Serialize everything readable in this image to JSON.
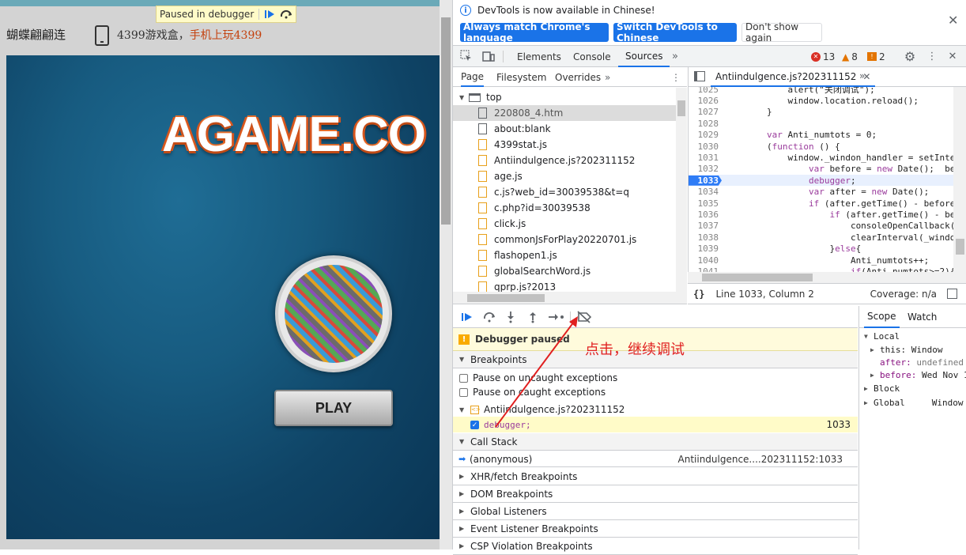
{
  "browser_page": {
    "paused_label": "Paused in debugger",
    "site_title": "蝴蝶翩翩连",
    "promo_text": "4399游戏盒，",
    "promo_highlight": "手机上玩4399",
    "game_logo": "AGAME.CO",
    "play_label": "PLAY"
  },
  "infobar": {
    "message": "DevTools is now available in Chinese!",
    "btn_match": "Always match Chrome's language",
    "btn_switch": "Switch DevTools to Chinese",
    "btn_dismiss": "Don't show again",
    "close": "✕"
  },
  "main_tabs": [
    "Elements",
    "Console",
    "Sources"
  ],
  "counts": {
    "errors": "13",
    "warnings": "8",
    "info": "2"
  },
  "nav_tabs": [
    "Page",
    "Filesystem",
    "Overrides"
  ],
  "tree": {
    "root": "top",
    "files": [
      {
        "name": "220808_4.htm",
        "type": "doc"
      },
      {
        "name": "about:blank",
        "type": "doc"
      },
      {
        "name": "4399stat.js",
        "type": "js"
      },
      {
        "name": "Antiindulgence.js?202311152",
        "type": "js"
      },
      {
        "name": "age.js",
        "type": "js"
      },
      {
        "name": "c.js?web_id=30039538&t=q",
        "type": "js"
      },
      {
        "name": "c.php?id=30039538",
        "type": "js"
      },
      {
        "name": "click.js",
        "type": "js"
      },
      {
        "name": "commonJsForPlay20220701.js",
        "type": "js"
      },
      {
        "name": "flashopen1.js",
        "type": "js"
      },
      {
        "name": "globalSearchWord.js",
        "type": "js"
      },
      {
        "name": "qprp.js?2013",
        "type": "js"
      }
    ]
  },
  "editor": {
    "tab": "Antiindulgence.js?202311152",
    "lines": [
      {
        "n": "1025",
        "code": "            alert(\"关闭调试\");"
      },
      {
        "n": "1026",
        "code": "            window.location.reload();"
      },
      {
        "n": "1027",
        "code": "        }"
      },
      {
        "n": "1028",
        "code": ""
      },
      {
        "n": "1029",
        "code": "        var Anti_numtots = 0;"
      },
      {
        "n": "1030",
        "code": "        (function () {"
      },
      {
        "n": "1031",
        "code": "            window._windon_handler = setInte"
      },
      {
        "n": "1032",
        "code": "                var before = new Date();  be"
      },
      {
        "n": "1033",
        "code": "                debugger;"
      },
      {
        "n": "1034",
        "code": "                var after = new Date();"
      },
      {
        "n": "1035",
        "code": "                if (after.getTime() - before"
      },
      {
        "n": "1036",
        "code": "                    if (after.getTime() - be"
      },
      {
        "n": "1037",
        "code": "                        consoleOpenCallback("
      },
      {
        "n": "1038",
        "code": "                        clearInterval(_windo"
      },
      {
        "n": "1039",
        "code": "                    }else{"
      },
      {
        "n": "1040",
        "code": "                        Anti_numtots++;"
      },
      {
        "n": "1041",
        "code": "                        if(Anti_numtots>=2){"
      }
    ],
    "current_line": "1033",
    "status_position": "Line 1033, Column 2",
    "coverage": "Coverage: n/a"
  },
  "debugger": {
    "paused": "Debugger paused",
    "breakpoints_header": "Breakpoints",
    "pause_uncaught": "Pause on uncaught exceptions",
    "pause_caught": "Pause on caught exceptions",
    "bp_file": "Antiindulgence.js?202311152",
    "bp_code": "debugger;",
    "bp_line": "1033",
    "callstack_header": "Call Stack",
    "frame_name": "(anonymous)",
    "frame_loc": "Antiindulgence....202311152:1033",
    "sections": [
      "XHR/fetch Breakpoints",
      "DOM Breakpoints",
      "Global Listeners",
      "Event Listener Breakpoints",
      "CSP Violation Breakpoints"
    ]
  },
  "scope": {
    "tabs": [
      "Scope",
      "Watch"
    ],
    "local": "Local",
    "this_key": "this:",
    "this_val": "Window",
    "after_key": "after:",
    "after_val": "undefined",
    "before_key": "before:",
    "before_val": "Wed Nov 1",
    "block": "Block",
    "global": "Global",
    "global_val": "Window"
  },
  "annotation": "点击，继续调试",
  "colors": {
    "accent": "#1a73e8",
    "error": "#d93025",
    "warning": "#e37400",
    "annotation": "#e02020"
  }
}
